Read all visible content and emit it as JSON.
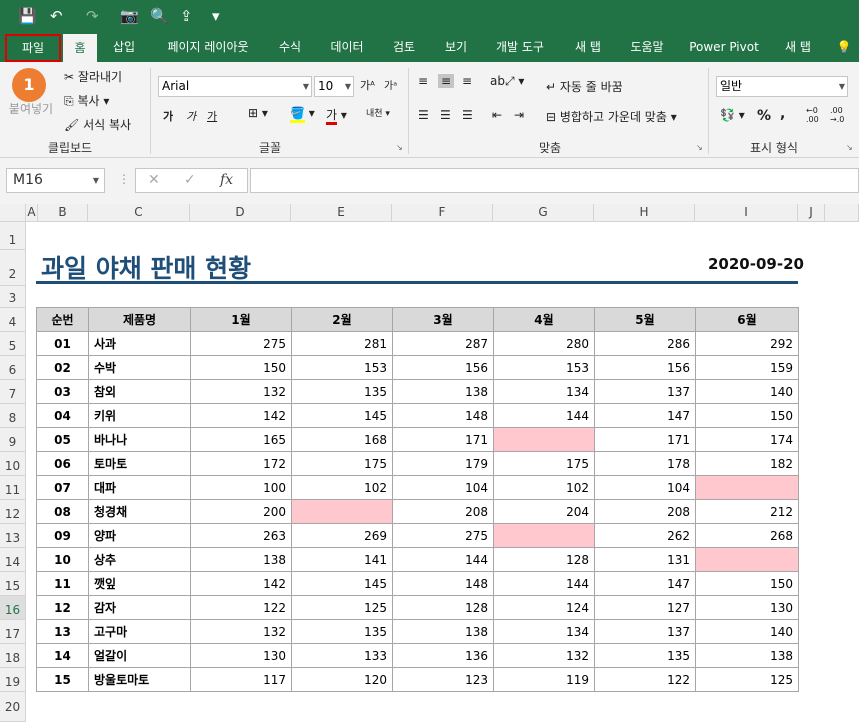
{
  "quick_access": {
    "save": "💾",
    "undo": "↶",
    "redo": "↷",
    "camera": "📷",
    "preview": "🔍",
    "more": "▾"
  },
  "tabs": [
    "파일",
    "홈",
    "삽입",
    "페이지 레이아웃",
    "수식",
    "데이터",
    "검토",
    "보기",
    "개발 도구",
    "새 탭",
    "도움말",
    "Power Pivot",
    "새 탭"
  ],
  "ribbon": {
    "clipboard": {
      "paste": "붙여넣기",
      "cut": "잘라내기",
      "copy": "복사",
      "format_painter": "서식 복사",
      "label": "클립보드"
    },
    "font": {
      "name": "Arial",
      "size": "10",
      "bold": "가",
      "italic": "가",
      "underline": "가",
      "label": "글꼴"
    },
    "alignment": {
      "wrap": "자동 줄 바꿈",
      "merge": "병합하고 가운데 맞춤",
      "label": "맞춤"
    },
    "number": {
      "format": "일반",
      "percent": "%",
      "comma": ",",
      "label": "표시 형식"
    }
  },
  "step_badge": "1",
  "formula_bar": {
    "name_box": "M16",
    "cancel": "✕",
    "enter": "✓",
    "fx": "fx",
    "value": ""
  },
  "columns": [
    "A",
    "B",
    "C",
    "D",
    "E",
    "F",
    "G",
    "H",
    "I",
    "J"
  ],
  "rows": [
    "1",
    "2",
    "3",
    "4",
    "5",
    "6",
    "7",
    "8",
    "9",
    "10",
    "11",
    "12",
    "13",
    "14",
    "15",
    "16",
    "17",
    "18",
    "19",
    "20"
  ],
  "sheet": {
    "title": "과일 야채 판매 현황",
    "date": "2020-09-20",
    "headers": [
      "순번",
      "제품명",
      "1월",
      "2월",
      "3월",
      "4월",
      "5월",
      "6월"
    ],
    "rows": [
      [
        "01",
        "사과",
        "275",
        "281",
        "287",
        "280",
        "286",
        "292"
      ],
      [
        "02",
        "수박",
        "150",
        "153",
        "156",
        "153",
        "156",
        "159"
      ],
      [
        "03",
        "참외",
        "132",
        "135",
        "138",
        "134",
        "137",
        "140"
      ],
      [
        "04",
        "키위",
        "142",
        "145",
        "148",
        "144",
        "147",
        "150"
      ],
      [
        "05",
        "바나나",
        "165",
        "168",
        "171",
        "",
        "171",
        "174"
      ],
      [
        "06",
        "토마토",
        "172",
        "175",
        "179",
        "175",
        "178",
        "182"
      ],
      [
        "07",
        "대파",
        "100",
        "102",
        "104",
        "102",
        "104",
        ""
      ],
      [
        "08",
        "청경채",
        "200",
        "",
        "208",
        "204",
        "208",
        "212"
      ],
      [
        "09",
        "양파",
        "263",
        "269",
        "275",
        "",
        "262",
        "268"
      ],
      [
        "10",
        "상추",
        "138",
        "141",
        "144",
        "128",
        "131",
        ""
      ],
      [
        "11",
        "깻잎",
        "142",
        "145",
        "148",
        "144",
        "147",
        "150"
      ],
      [
        "12",
        "감자",
        "122",
        "125",
        "128",
        "124",
        "127",
        "130"
      ],
      [
        "13",
        "고구마",
        "132",
        "135",
        "138",
        "134",
        "137",
        "140"
      ],
      [
        "14",
        "얼갈이",
        "130",
        "133",
        "136",
        "132",
        "135",
        "138"
      ],
      [
        "15",
        "방울토마토",
        "117",
        "120",
        "123",
        "119",
        "122",
        "125"
      ]
    ],
    "highlight_color": "#ffc7ce"
  },
  "colors": {
    "excel_green": "#217346",
    "title_blue": "#1f4e79",
    "file_tab_outline": "#e00000",
    "badge_orange": "#ed7d31"
  }
}
